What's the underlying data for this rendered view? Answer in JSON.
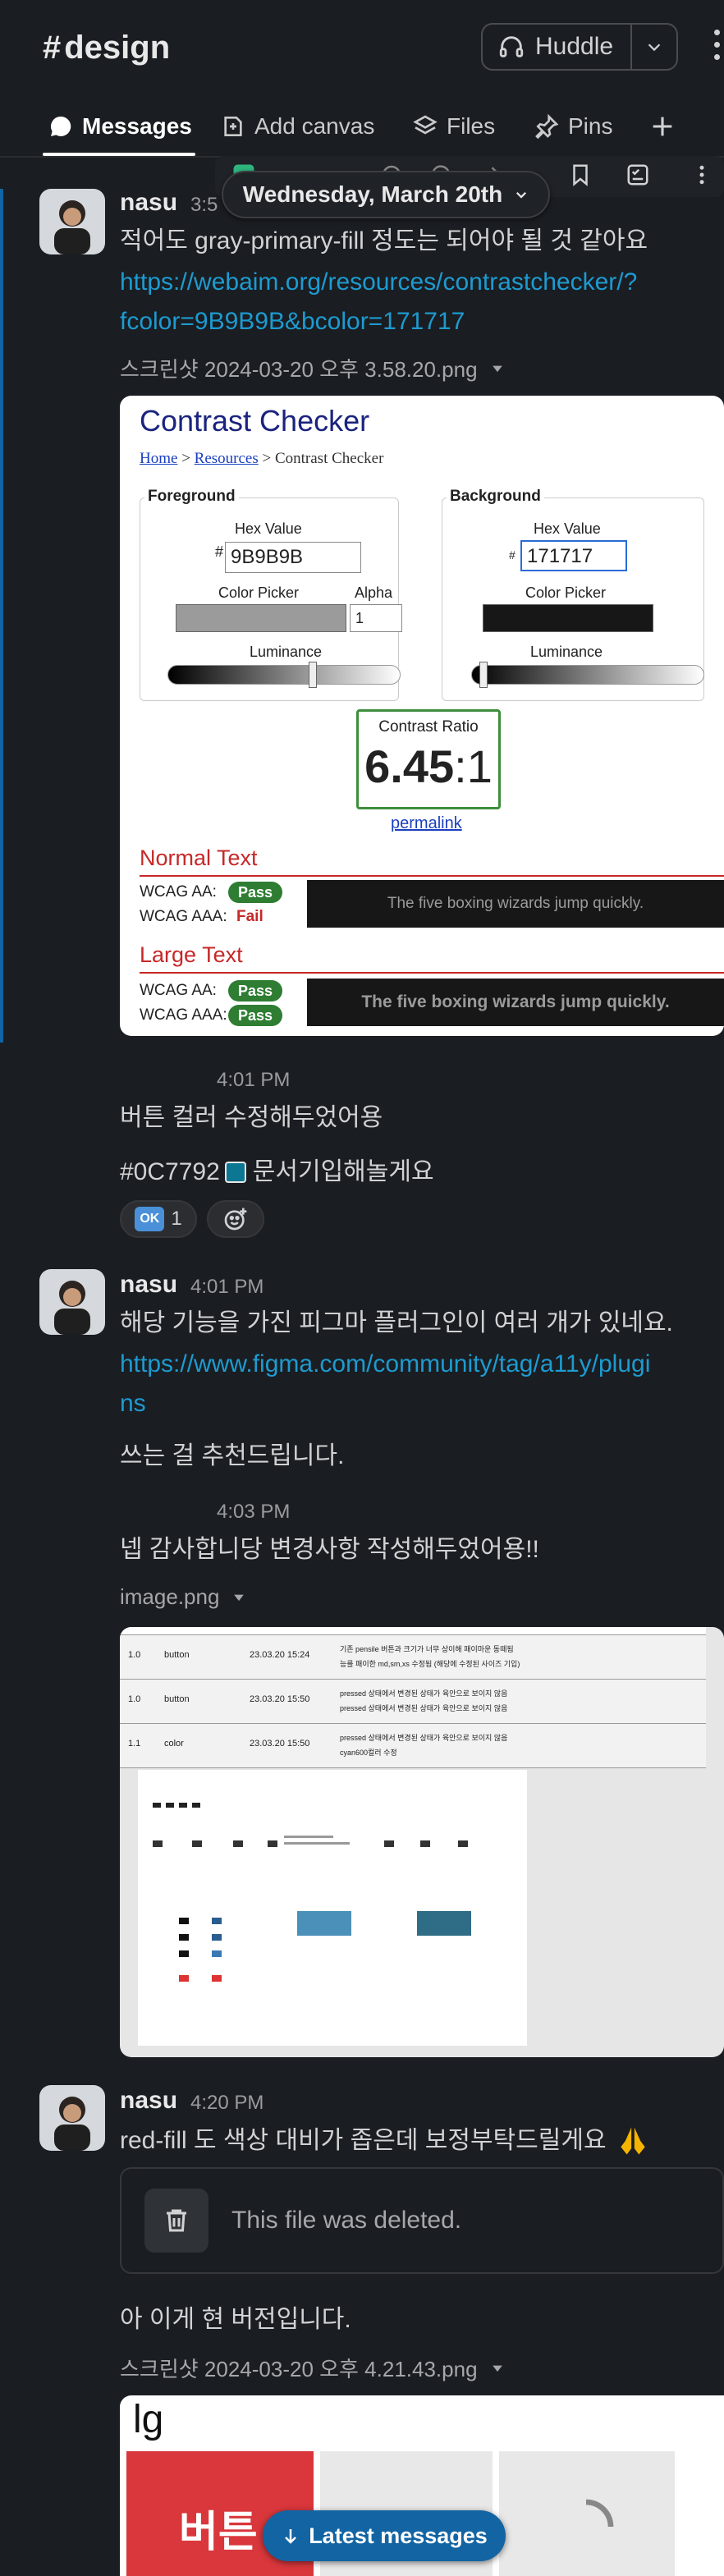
{
  "channel": {
    "hash": "#",
    "name": "design"
  },
  "huddle": {
    "label": "Huddle"
  },
  "tabs": [
    {
      "label": "Messages"
    },
    {
      "label": "Add canvas"
    },
    {
      "label": "Files"
    },
    {
      "label": "Pins"
    }
  ],
  "date_divider": "Wednesday, March 20th",
  "messages": {
    "m1": {
      "author": "nasu",
      "time": "3:5",
      "text": "적어도 gray-primary-fill 정도는 되어야 될 것 같아요",
      "link_line1": "https://webaim.org/resources/contrastchecker/?",
      "link_line2": "fcolor=9B9B9B&bcolor=171717",
      "file": "스크린샷 2024-03-20 오후 3.58.20.png"
    },
    "m2": {
      "time": "4:01 PM",
      "text1": "버튼 컬러 수정해두었어용",
      "text2_prefix": "#0C7792",
      "text2_suffix": "문서기입해놀게요",
      "reaction_emoji": "OK",
      "reaction_count": "1",
      "swatch_color": "#0C7792"
    },
    "m3": {
      "author": "nasu",
      "time": "4:01 PM",
      "text": "해당 기능을 가진 피그마 플러그인이 여러 개가 있네요.",
      "link_line1": "https://www.figma.com/community/tag/a11y/plugi",
      "link_line2": "ns",
      "text2": "쓰는 걸 추천드립니다."
    },
    "m4": {
      "time": "4:03 PM",
      "text": "넵 감사합니당 변경사항 작성해두었어용!!",
      "file": "image.png"
    },
    "m5": {
      "author": "nasu",
      "time": "4:20 PM",
      "text": "red-fill 도 색상 대비가 좁은데 보정부탁드릴게요",
      "deleted": "This file was deleted.",
      "text2": "아 이게 현 버전입니다.",
      "file": "스크린샷 2024-03-20 오후 4.21.43.png"
    }
  },
  "contrast_checker": {
    "title": "Contrast Checker",
    "crumb_home": "Home",
    "crumb_sep": ">",
    "crumb_resources": "Resources",
    "crumb_current": "> Contrast Checker",
    "foreground": "Foreground",
    "background": "Background",
    "hex_label": "Hex Value",
    "fg_hex": "9B9B9B",
    "bg_hex": "171717",
    "color_picker": "Color Picker",
    "alpha_label": "Alpha",
    "alpha_value": "1",
    "luminance": "Luminance",
    "ratio_label": "Contrast Ratio",
    "ratio_bold": "6.45",
    "ratio_rest": ":1",
    "permalink": "permalink",
    "normal_text": "Normal Text",
    "large_text": "Large Text",
    "wcag_aa": "WCAG AA:",
    "wcag_aaa": "WCAG AAA:",
    "pass": "Pass",
    "fail": "Fail",
    "sample": "The five boxing wizards jump quickly.",
    "fg_color": "#9B9B9B",
    "bg_color": "#171717"
  },
  "image_preview": {
    "rows": [
      {
        "version": "1.0",
        "component": "button",
        "date": "23.03.20 15:24",
        "note1": "기존 pensile 버튼과 크기가 너무 상이해 패이마운 동떼됨",
        "note2": "능를 패이한 md,sm,xs 수정됨 (해당에 수정된 사이즈 기입)"
      },
      {
        "version": "1.0",
        "component": "button",
        "date": "23.03.20 15:50",
        "note1": "pressed 상태에서 변경된 상태가 육안으로 보이지 않음",
        "note2": "pressed 상태에서 변경된 상태가 육안으로 보이지 않음"
      },
      {
        "version": "1.1",
        "component": "color",
        "date": "23.03.20 15:50",
        "note1": "pressed 상태에서 변경된 상태가 육안으로 보이지 않음",
        "note2": "cyan600컬러 수정"
      }
    ]
  },
  "bottom_preview": {
    "label": "lg",
    "button_text": "버튼"
  },
  "latest_button": "Latest messages",
  "colors": {
    "accent": "#1264a3",
    "link": "#1d9bd1",
    "pass_green": "#2e7d32",
    "fail_red": "#c62828",
    "bg": "#1a1d21"
  }
}
